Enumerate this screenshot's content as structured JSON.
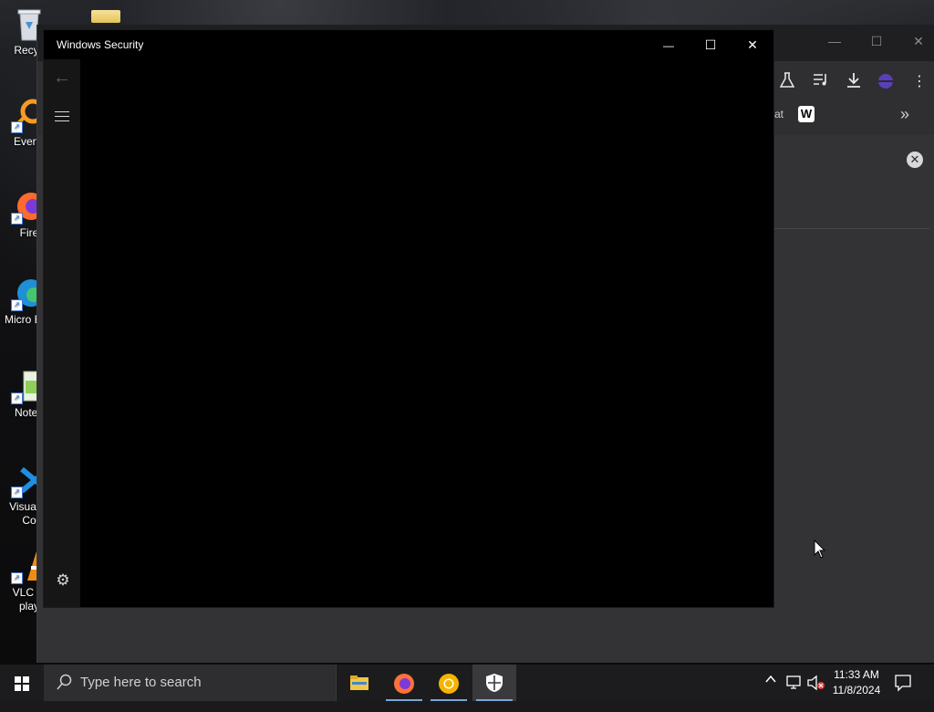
{
  "desktop": {
    "icons": [
      {
        "label": "Recyc",
        "icon": "recycle-bin-icon"
      },
      {
        "label": "Everyt",
        "icon": "everything-search-icon"
      },
      {
        "label": "Fire",
        "icon": "firefox-icon"
      },
      {
        "label": "Micro Edg",
        "icon": "edge-icon"
      },
      {
        "label": "Notep",
        "icon": "notepad-icon"
      },
      {
        "label": "Visual S Co",
        "icon": "vscode-icon"
      },
      {
        "label": "VLC m play",
        "icon": "vlc-icon"
      }
    ]
  },
  "browser": {
    "bookmark_partial": "at",
    "bookmark_badge": "W",
    "overflow": "»"
  },
  "security_window": {
    "title": "Windows Security",
    "minimize": "—",
    "maximize": "☐",
    "close": "✕",
    "back": "←",
    "settings": "⚙"
  },
  "taskbar": {
    "search_placeholder": "Type here to search",
    "apps": [
      "file-explorer-icon",
      "firefox-icon",
      "chrome-icon",
      "windows-security-icon"
    ],
    "tray_chevron": "^",
    "time": "11:33 AM",
    "date": "11/8/2024"
  }
}
